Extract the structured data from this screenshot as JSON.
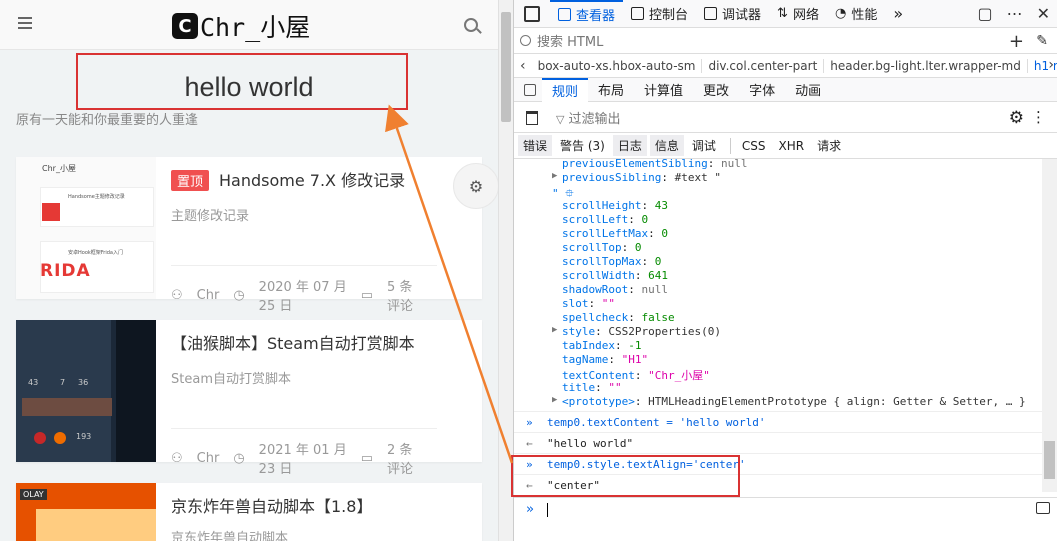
{
  "site": {
    "logo_letter": "C",
    "logo_text": "Chr_小屋",
    "heading": "hello world",
    "subtitle": "原有一天能和你最重要的人重逢"
  },
  "posts": [
    {
      "badge": "置顶",
      "title": "Handsome 7.X 修改记录",
      "summary": "主题修改记录",
      "author": "Chr",
      "date": "2020 年 07 月 25 日",
      "comments": "5 条评论",
      "thumb": {
        "site": "Chr_小屋",
        "line1": "Handsome主题修改记录",
        "line2": "安卓Hook框架Frida入门",
        "brand": "RIDA"
      }
    },
    {
      "badge": "",
      "title": "【油猴脚本】Steam自动打赏脚本",
      "summary": "Steam自动打赏脚本",
      "author": "Chr",
      "date": "2021 年 01 月 23 日",
      "comments": "2 条评论",
      "thumb": {
        "n1": "43",
        "n2": "7",
        "n3": "36",
        "n4": "193"
      }
    },
    {
      "badge": "",
      "title": "京东炸年兽自动脚本【1.8】",
      "summary": "京东炸年兽自动脚本",
      "author": "",
      "date": "",
      "comments": "",
      "thumb": {
        "brand": "OLAY"
      }
    }
  ],
  "devtools": {
    "tabs": [
      {
        "label": "查看器",
        "selected": true
      },
      {
        "label": "控制台",
        "selected": false
      },
      {
        "label": "调试器",
        "selected": false
      },
      {
        "label": "网络",
        "selected": false
      },
      {
        "label": "性能",
        "selected": false
      }
    ],
    "more_tabs": "»",
    "search_placeholder": "搜索 HTML",
    "breadcrumb": [
      "box-auto-xs.hbox-auto-sm",
      "div.col.center-part",
      "header.bg-light.lter.wrapper-md",
      "h1.m-"
    ],
    "subtabs": [
      "规则",
      "布局",
      "计算值",
      "更改",
      "字体",
      "动画"
    ],
    "filter_placeholder": "过滤输出",
    "levels": [
      {
        "label": "错误",
        "on": true
      },
      {
        "label": "警告 (3)",
        "on": false
      },
      {
        "label": "日志",
        "on": true
      },
      {
        "label": "信息",
        "on": true
      },
      {
        "label": "调试",
        "on": false
      }
    ],
    "types": [
      "CSS",
      "XHR",
      "请求"
    ],
    "props": [
      {
        "k": "previousElementSibling",
        "v": "null",
        "t": "null",
        "tw": false
      },
      {
        "k": "previousSibling",
        "v": "#text \"",
        "t": "obj",
        "tw": true
      },
      {
        "k": "\" ⯐",
        "v": "",
        "t": "str",
        "tw": false
      },
      {
        "k": "scrollHeight",
        "v": "43",
        "t": "num",
        "tw": false
      },
      {
        "k": "scrollLeft",
        "v": "0",
        "t": "num",
        "tw": false
      },
      {
        "k": "scrollLeftMax",
        "v": "0",
        "t": "num",
        "tw": false
      },
      {
        "k": "scrollTop",
        "v": "0",
        "t": "num",
        "tw": false
      },
      {
        "k": "scrollTopMax",
        "v": "0",
        "t": "num",
        "tw": false
      },
      {
        "k": "scrollWidth",
        "v": "641",
        "t": "num",
        "tw": false
      },
      {
        "k": "shadowRoot",
        "v": "null",
        "t": "null",
        "tw": false
      },
      {
        "k": "slot",
        "v": "\"\"",
        "t": "str",
        "tw": false
      },
      {
        "k": "spellcheck",
        "v": "false",
        "t": "num",
        "tw": false
      },
      {
        "k": "style",
        "v": "CSS2Properties(0)",
        "t": "obj",
        "tw": true
      },
      {
        "k": "tabIndex",
        "v": "-1",
        "t": "num",
        "tw": false
      },
      {
        "k": "tagName",
        "v": "\"H1\"",
        "t": "str",
        "tw": false
      },
      {
        "k": "textContent",
        "v": "\"Chr_小屋\"",
        "t": "str",
        "tw": false
      },
      {
        "k": "title",
        "v": "\"\"",
        "t": "str",
        "tw": false
      },
      {
        "k": "<prototype>",
        "v": "HTMLHeadingElementPrototype { align: Getter & Setter, … }",
        "t": "obj",
        "tw": true
      }
    ],
    "console_lines": [
      {
        "sym": "»",
        "text": "temp0.textContent = 'hello world'",
        "out": false
      },
      {
        "sym": "←",
        "text": "\"hello world\"",
        "out": true
      },
      {
        "sym": "»",
        "text": "temp0.style.textAlign='center'",
        "out": false
      },
      {
        "sym": "←",
        "text": "\"center\"",
        "out": true
      }
    ],
    "prompt": "»"
  },
  "colors": {
    "accent": "#0060df",
    "highlight": "#d93232",
    "arrow": "#f08030",
    "badge": "#f05050"
  }
}
